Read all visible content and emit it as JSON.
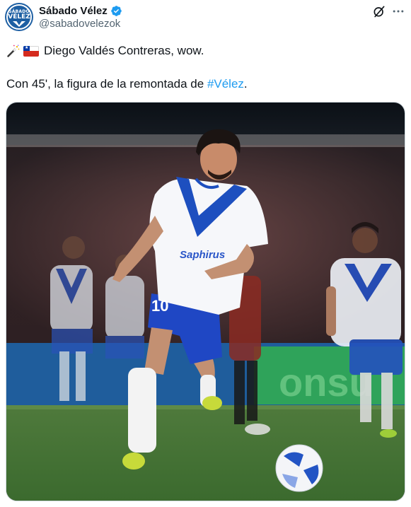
{
  "author": {
    "display_name": "Sábado Vélez",
    "handle": "@sabadovelezok",
    "verified": true,
    "avatar_text_top": "SÁBADO",
    "avatar_text_main": "VÉLEZ"
  },
  "post": {
    "line1_text": "Diego Valdés Contreras, wow.",
    "line2_prefix": "Con 45', la figura de la remontada de ",
    "hashtag": "#Vélez",
    "line2_suffix": ".",
    "emoji_1": "magic-wand-icon",
    "emoji_2": "chile-flag-icon"
  },
  "media": {
    "shirt_number": "10",
    "sponsor": "Saphirus",
    "ad_board_text": "onsu"
  },
  "colors": {
    "text_primary": "#0f1419",
    "text_secondary": "#536471",
    "link": "#1d9bf0",
    "verified": "#1d9bf0",
    "velez_blue": "#1d4fbf"
  }
}
